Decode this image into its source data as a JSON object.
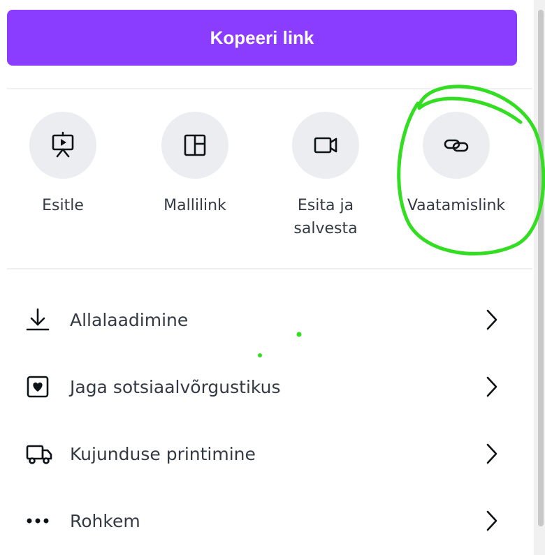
{
  "copy_link": {
    "label": "Kopeeri link"
  },
  "share_options": [
    {
      "label": "Esitle",
      "icon": "presentation-icon"
    },
    {
      "label": "Mallilink",
      "icon": "template-layout-icon"
    },
    {
      "label_line1": "Esita ja",
      "label_line2": "salvesta",
      "icon": "video-camera-icon"
    },
    {
      "label": "Vaatamislink",
      "icon": "link-icon"
    }
  ],
  "menu": [
    {
      "label": "Allalaadimine",
      "icon": "download-icon"
    },
    {
      "label": "Jaga sotsiaalvõrgustikus",
      "icon": "social-heart-icon"
    },
    {
      "label": "Kujunduse printimine",
      "icon": "delivery-truck-icon"
    },
    {
      "label": "Rohkem",
      "icon": "more-dots-icon"
    }
  ],
  "colors": {
    "accent": "#8b3dff",
    "annotation": "#33dd22",
    "circle_bg": "#ebedf0"
  }
}
